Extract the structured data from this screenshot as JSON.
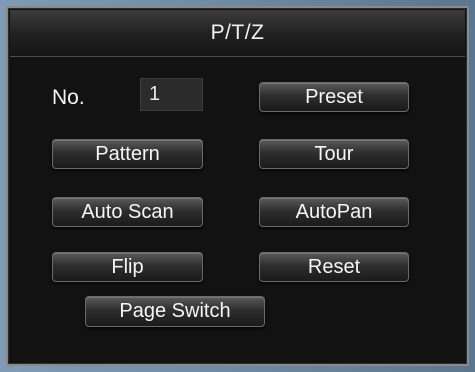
{
  "dialog": {
    "title": "P/T/Z"
  },
  "number": {
    "label": "No.",
    "value": "1"
  },
  "buttons": {
    "preset": "Preset",
    "pattern": "Pattern",
    "tour": "Tour",
    "auto_scan": "Auto Scan",
    "auto_pan": "AutoPan",
    "flip": "Flip",
    "reset": "Reset",
    "page_switch": "Page Switch"
  }
}
